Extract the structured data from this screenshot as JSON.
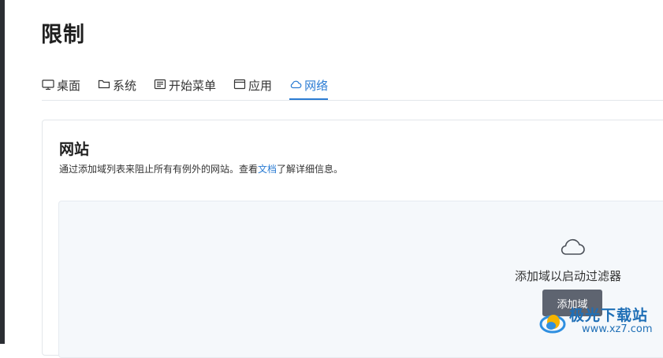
{
  "page": {
    "title": "限制"
  },
  "tabs": [
    {
      "label": "桌面",
      "icon": "monitor-icon",
      "active": false
    },
    {
      "label": "系统",
      "icon": "folder-icon",
      "active": false
    },
    {
      "label": "开始菜单",
      "icon": "start-menu-icon",
      "active": false
    },
    {
      "label": "应用",
      "icon": "app-window-icon",
      "active": false
    },
    {
      "label": "网络",
      "icon": "cloud-icon",
      "active": true
    }
  ],
  "websites": {
    "title": "网站",
    "description_before": "通过添加域列表来阻止所有有例外的网站。查看",
    "description_link": "文档",
    "description_after": "了解详细信息。",
    "empty_icon": "cloud-icon",
    "empty_text": "添加域以启动过滤器",
    "add_button_label": "添加域"
  },
  "watermark": {
    "line1": "极光下载站",
    "line2": "www.xz7.com"
  },
  "colors": {
    "accent": "#2b7cd3",
    "button": "#5e6470",
    "panel_bg": "#f5f8fb",
    "left_strip": "#2b2e33"
  }
}
